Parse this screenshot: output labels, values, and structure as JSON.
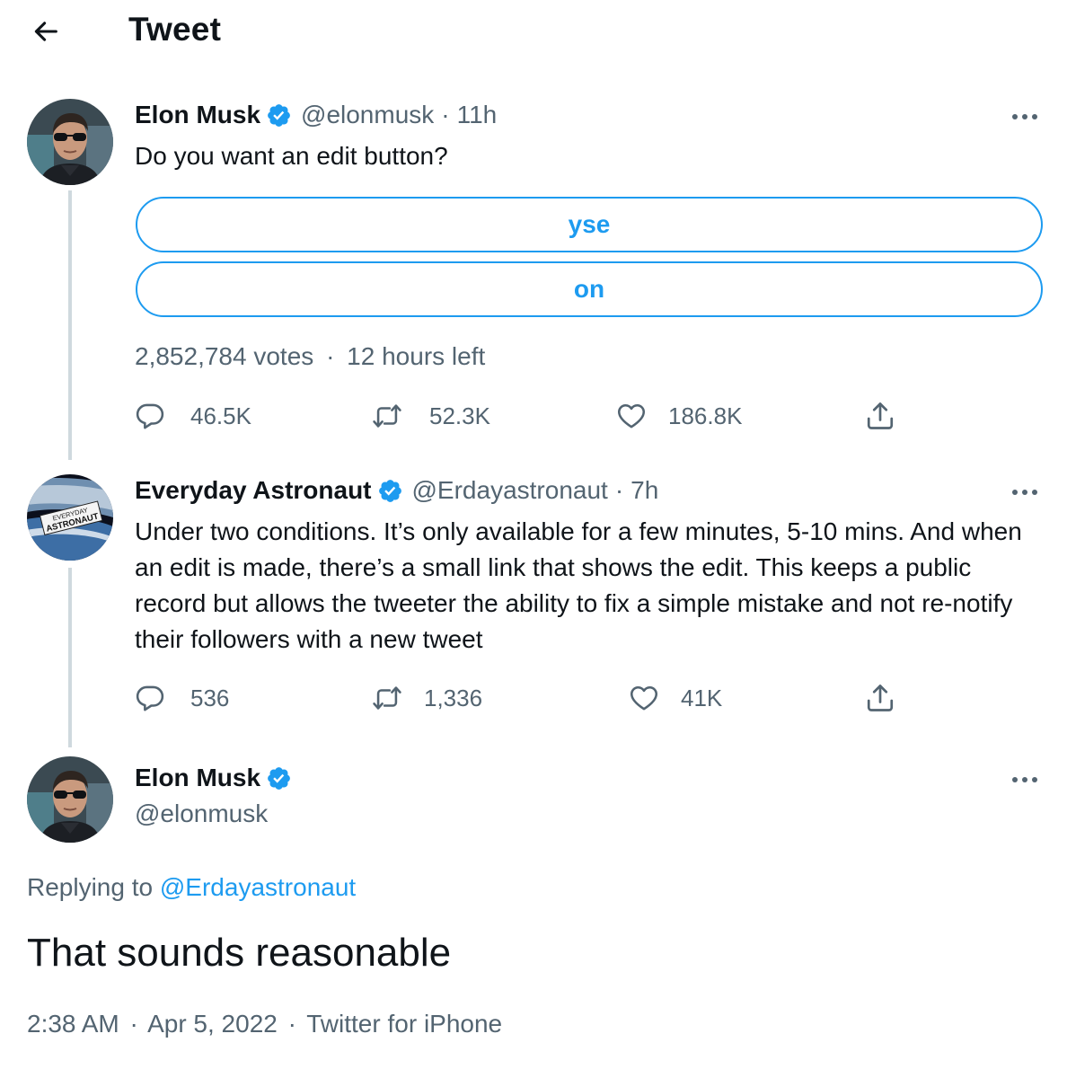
{
  "header": {
    "title": "Tweet",
    "back_icon": "arrow-left-icon"
  },
  "colors": {
    "accent": "#1d9bf0",
    "text": "#0f1419",
    "secondary": "#536471",
    "thread_line": "#cfd9de"
  },
  "tweet1": {
    "name": "Elon Musk",
    "handle": "@elonmusk",
    "separator": "·",
    "time": "11h",
    "text": "Do you want an edit button?",
    "poll": {
      "options": [
        "yse",
        "on"
      ],
      "votes": "2,852,784 votes",
      "separator": "·",
      "time_left": "12 hours left"
    },
    "actions": {
      "replies": "46.5K",
      "retweets": "52.3K",
      "likes": "186.8K"
    }
  },
  "tweet2": {
    "name": "Everyday Astronaut",
    "handle": "@Erdayastronaut",
    "separator": "·",
    "time": "7h",
    "avatar_label_line1": "EVERYDAY",
    "avatar_label_line2": "ASTRONAUT",
    "text": "Under two conditions. It’s only available for a few minutes, 5-10 mins. And when an edit is made, there’s a small link that shows the edit. This keeps a public record but allows the tweeter the ability to fix a simple mistake and not re-notify their followers with a new tweet",
    "actions": {
      "replies": "536",
      "retweets": "1,336",
      "likes": "41K"
    }
  },
  "tweet3": {
    "name": "Elon Musk",
    "handle": "@elonmusk",
    "replying_prefix": "Replying to",
    "replying_to": "@Erdayastronaut",
    "text": "That sounds reasonable",
    "timestamp": "2:38 AM",
    "sep1": "·",
    "date": "Apr 5, 2022",
    "sep2": "·",
    "source": "Twitter for iPhone"
  }
}
